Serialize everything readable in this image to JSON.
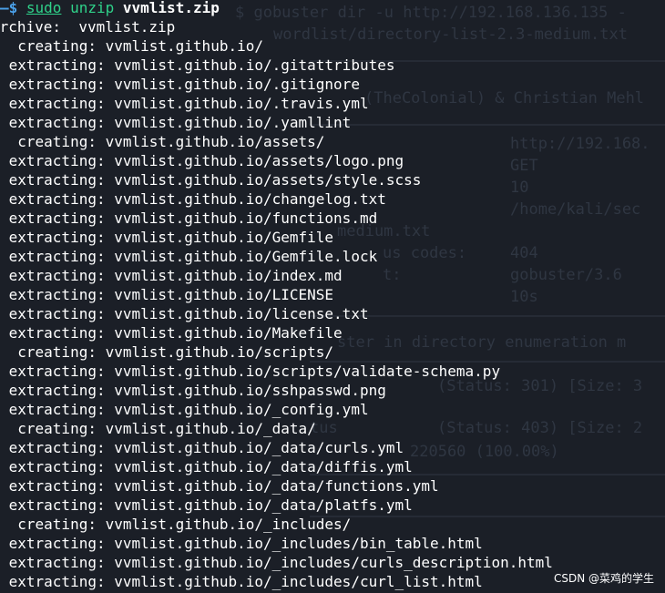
{
  "prompt": {
    "arrow": "—$",
    "sudo": "sudo",
    "command": "unzip",
    "file": "vvmlist.zip"
  },
  "archive_line": "Archive:  vvmlist.zip",
  "output_lines": [
    "  creating: vvmlist.github.io/",
    " extracting: vvmlist.github.io/.gitattributes",
    " extracting: vvmlist.github.io/.gitignore",
    " extracting: vvmlist.github.io/.travis.yml",
    " extracting: vvmlist.github.io/.yamllint",
    "  creating: vvmlist.github.io/assets/",
    " extracting: vvmlist.github.io/assets/logo.png",
    " extracting: vvmlist.github.io/assets/style.scss",
    " extracting: vvmlist.github.io/changelog.txt",
    " extracting: vvmlist.github.io/functions.md",
    " extracting: vvmlist.github.io/Gemfile",
    " extracting: vvmlist.github.io/Gemfile.lock",
    " extracting: vvmlist.github.io/index.md",
    " extracting: vvmlist.github.io/LICENSE",
    " extracting: vvmlist.github.io/license.txt",
    " extracting: vvmlist.github.io/Makefile",
    "  creating: vvmlist.github.io/scripts/",
    " extracting: vvmlist.github.io/scripts/validate-schema.py",
    " extracting: vvmlist.github.io/sshpasswd.png",
    " extracting: vvmlist.github.io/_config.yml",
    "  creating: vvmlist.github.io/_data/",
    " extracting: vvmlist.github.io/_data/curls.yml",
    " extracting: vvmlist.github.io/_data/diffis.yml",
    " extracting: vvmlist.github.io/_data/functions.yml",
    " extracting: vvmlist.github.io/_data/platfs.yml",
    "  creating: vvmlist.github.io/_includes/",
    " extracting: vvmlist.github.io/_includes/bin_table.html",
    " extracting: vvmlist.github.io/_includes/curls_description.html",
    " extracting: vvmlist.github.io/_includes/curl_list.html"
  ],
  "ghost_text": [
    "$ gobuster dir -u http://192.168.136.135 -",
    "wordlist/directory-list-2.3-medium.txt",
    "(TheColonial) & Christian Mehl",
    "http://192.168.",
    "GET",
    "10",
    "/home/kali/sec",
    "medium.txt",
    "us codes:",
    "404",
    "t:",
    "gobuster/3.6",
    "10s",
    "ster in directory enumeration m",
    "(Status: 301) [Size: 3",
    "tus",
    "(Status: 403) [Size: 2",
    "220560 (100.00%)"
  ],
  "watermark": "CSDN @菜鸡的学生"
}
